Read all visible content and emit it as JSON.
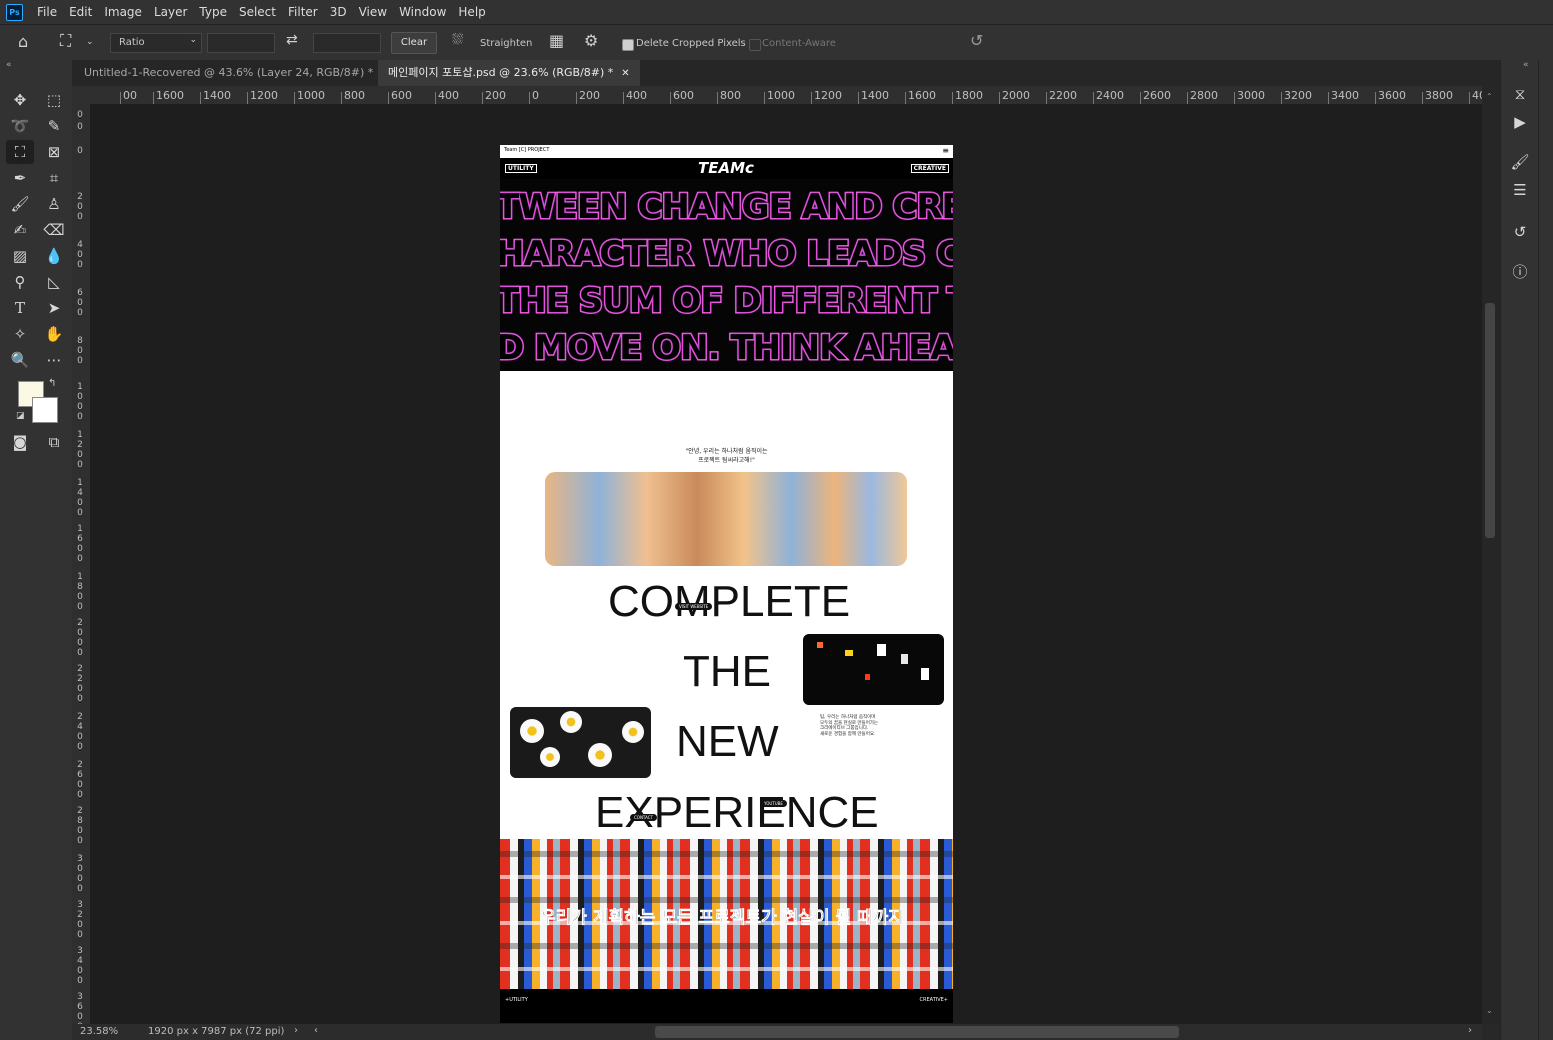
{
  "app": {
    "logo": "Ps"
  },
  "menu": [
    "File",
    "Edit",
    "Image",
    "Layer",
    "Type",
    "Select",
    "Filter",
    "3D",
    "View",
    "Window",
    "Help"
  ],
  "options": {
    "ratio_label": "Ratio",
    "clear_label": "Clear",
    "straighten_label": "Straighten",
    "delete_cropped_label": "Delete Cropped Pixels",
    "delete_cropped_checked": true,
    "content_aware_label": "Content-Aware",
    "content_aware_checked": false
  },
  "tabs": [
    {
      "label": "Untitled-1-Recovered @ 43.6% (Layer 24, RGB/8#) *",
      "active": false
    },
    {
      "label": "메인페이지 포토샵.psd @ 23.6% (RGB/8#) *",
      "active": true
    }
  ],
  "ruler_h": [
    "00",
    "1600",
    "1400",
    "1200",
    "1000",
    "800",
    "600",
    "400",
    "200",
    "0",
    "200",
    "400",
    "600",
    "800",
    "1000",
    "1200",
    "1400",
    "1600",
    "1800",
    "2000",
    "2200",
    "2400",
    "2600",
    "2800",
    "3000",
    "3200",
    "3400",
    "3600",
    "3800",
    "4000"
  ],
  "ruler_v": [
    "0",
    "0",
    "0",
    "200",
    "400",
    "600",
    "800",
    "1000",
    "1200",
    "1400",
    "1600",
    "1800",
    "2000",
    "2200",
    "2400",
    "2600",
    "2800",
    "3000",
    "3200",
    "3400",
    "3600"
  ],
  "status": {
    "zoom": "23.58%",
    "doc_info": "1920 px x 7987 px (72 ppi)"
  },
  "design": {
    "top_label": "Team [C] PROJECT",
    "nav_left": "UTILITY",
    "nav_right": "CREATIVE",
    "logo": "TEAMc",
    "hero_lines": [
      "TWEEN CHANGE AND CREA",
      "HARACTER WHO LEADS CH",
      "THE SUM OF DIFFERENT TA",
      "D MOVE ON. THINK AHEAD"
    ],
    "quote_line1": "\"안녕, 우리는 하나처럼 움직이는",
    "quote_line2": "프로젝트 팀씨라고해!\"",
    "words": [
      "COMPLETE",
      "THE",
      "NEW",
      "EXPERIENCE"
    ],
    "pill_1": "VISIT WEBSITE",
    "pill_2": "YOUTUBE",
    "pill_3": "CONTACT",
    "para": [
      "팀, 우리는 하나처럼 움직이며",
      "모두의 꿈을 현실로 만들어가는",
      "크리에이티브 그룹입니다.",
      "새로운 경험을 함께 만들어요."
    ],
    "banner_text": "우리가 계획하는 모든 프로젝트가 현실이 될 때까지",
    "footer_left": "+UTILITY",
    "footer_right": "CREATIVE+"
  },
  "colors": {
    "hero_outline": "#ff66e6",
    "ps_blue": "#31a8ff"
  }
}
